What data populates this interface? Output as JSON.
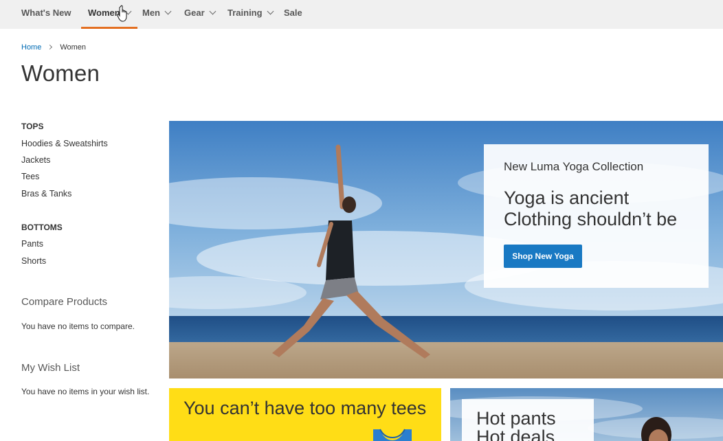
{
  "nav": {
    "items": [
      {
        "label": "What's New",
        "dropdown": false,
        "active": false
      },
      {
        "label": "Women",
        "dropdown": true,
        "active": true
      },
      {
        "label": "Men",
        "dropdown": true,
        "active": false
      },
      {
        "label": "Gear",
        "dropdown": true,
        "active": false
      },
      {
        "label": "Training",
        "dropdown": true,
        "active": false
      },
      {
        "label": "Sale",
        "dropdown": false,
        "active": false
      }
    ]
  },
  "breadcrumb": {
    "home": "Home",
    "current": "Women"
  },
  "page_title": "Women",
  "sidebar": {
    "tops": {
      "heading": "TOPS",
      "links": [
        "Hoodies & Sweatshirts",
        "Jackets",
        "Tees",
        "Bras & Tanks"
      ]
    },
    "bottoms": {
      "heading": "BOTTOMS",
      "links": [
        "Pants",
        "Shorts"
      ]
    },
    "compare": {
      "title": "Compare Products",
      "text": "You have no items to compare."
    },
    "wishlist": {
      "title": "My Wish List",
      "text": "You have no items in your wish list."
    }
  },
  "hero": {
    "subtitle": "New Luma Yoga Collection",
    "headline_line1": "Yoga is ancient",
    "headline_line2": "Clothing shouldn’t be",
    "button_label": "Shop New Yoga"
  },
  "promos": {
    "tees_text": "You can’t have too many tees",
    "pants_line1": "Hot pants",
    "pants_line2": "Hot deals"
  },
  "colors": {
    "nav_bg": "#f0f0f0",
    "active_underline": "#e36f21",
    "link_blue": "#006bb4",
    "button_blue": "#1979c3",
    "promo_yellow": "#ffdd16"
  },
  "icons": {
    "cursor": "hand-pointer-icon",
    "chevron": "chevron-down-icon",
    "separator": "chevron-right-icon"
  }
}
